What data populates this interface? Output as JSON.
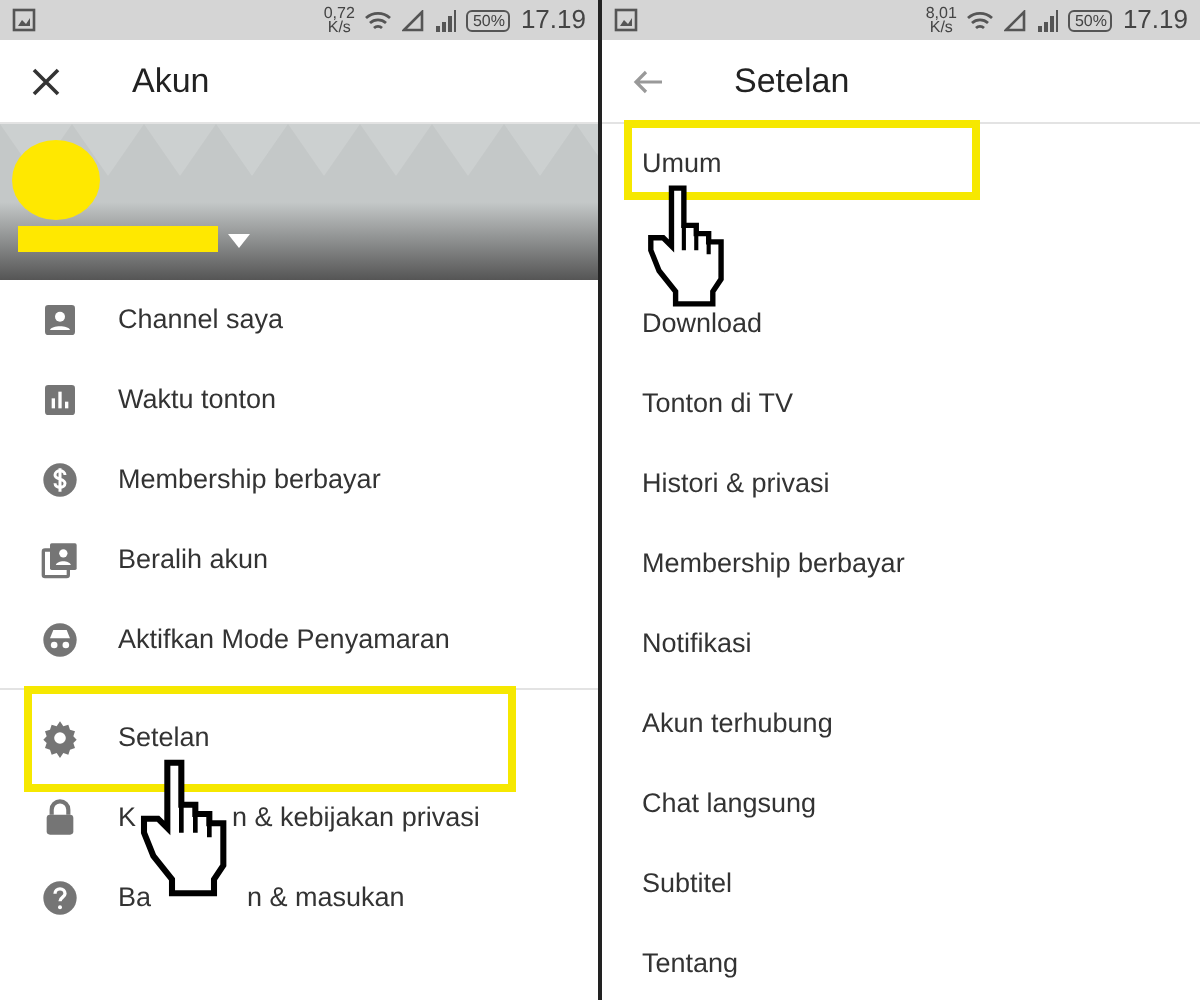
{
  "panels": [
    {
      "kind": "account",
      "status_bar": {
        "speed": "0,72",
        "speed_unit": "K/s",
        "battery": "50%",
        "time": "17.19"
      },
      "app_bar": {
        "title": "Akun"
      },
      "account_banner": {
        "kind": "picture"
      },
      "sections": [
        [
          {
            "label_parts": [
              "Channel saya"
            ],
            "highlighted": false
          },
          {
            "label_parts": [
              "Waktu tonton"
            ],
            "highlighted": false
          },
          {
            "label_parts": [
              "Membership berbayar"
            ],
            "highlighted": false
          },
          {
            "label_parts": [
              "Beralih akun"
            ],
            "highlighted": false
          },
          {
            "label_parts": [
              "Aktifkan Mode Penyamaran"
            ],
            "highlighted": false
          }
        ],
        [
          {
            "label_parts": [
              "Setelan"
            ],
            "highlighted": true
          },
          {
            "label_parts": [
              "K",
              "n & kebijakan privasi"
            ],
            "highlighted": false
          },
          {
            "label_parts": [
              "Ba",
              "n & masukan"
            ],
            "highlighted": false
          }
        ]
      ]
    },
    {
      "kind": "settings",
      "status_bar": {
        "speed": "8,01",
        "speed_unit": "K/s",
        "battery": "50%",
        "time": "17.19"
      },
      "app_bar": {
        "title": "Setelan"
      },
      "sections": [
        [
          {
            "label_parts": [
              "Umum"
            ],
            "highlighted": true
          },
          {
            "label_parts": [
              "Download"
            ],
            "highlighted": false
          },
          {
            "label_parts": [
              "Tonton di TV"
            ],
            "highlighted": false
          },
          {
            "label_parts": [
              "Histori & privasi"
            ],
            "highlighted": false
          },
          {
            "label_parts": [
              "Membership berbayar"
            ],
            "highlighted": false
          },
          {
            "label_parts": [
              "Notifikasi"
            ],
            "highlighted": false
          },
          {
            "label_parts": [
              "Akun terhubung"
            ],
            "highlighted": false
          },
          {
            "label_parts": [
              "Chat langsung"
            ],
            "highlighted": false
          },
          {
            "label_parts": [
              "Subtitel"
            ],
            "highlighted": false
          },
          {
            "label_parts": [
              "Tentang"
            ],
            "highlighted": false
          }
        ]
      ]
    }
  ]
}
